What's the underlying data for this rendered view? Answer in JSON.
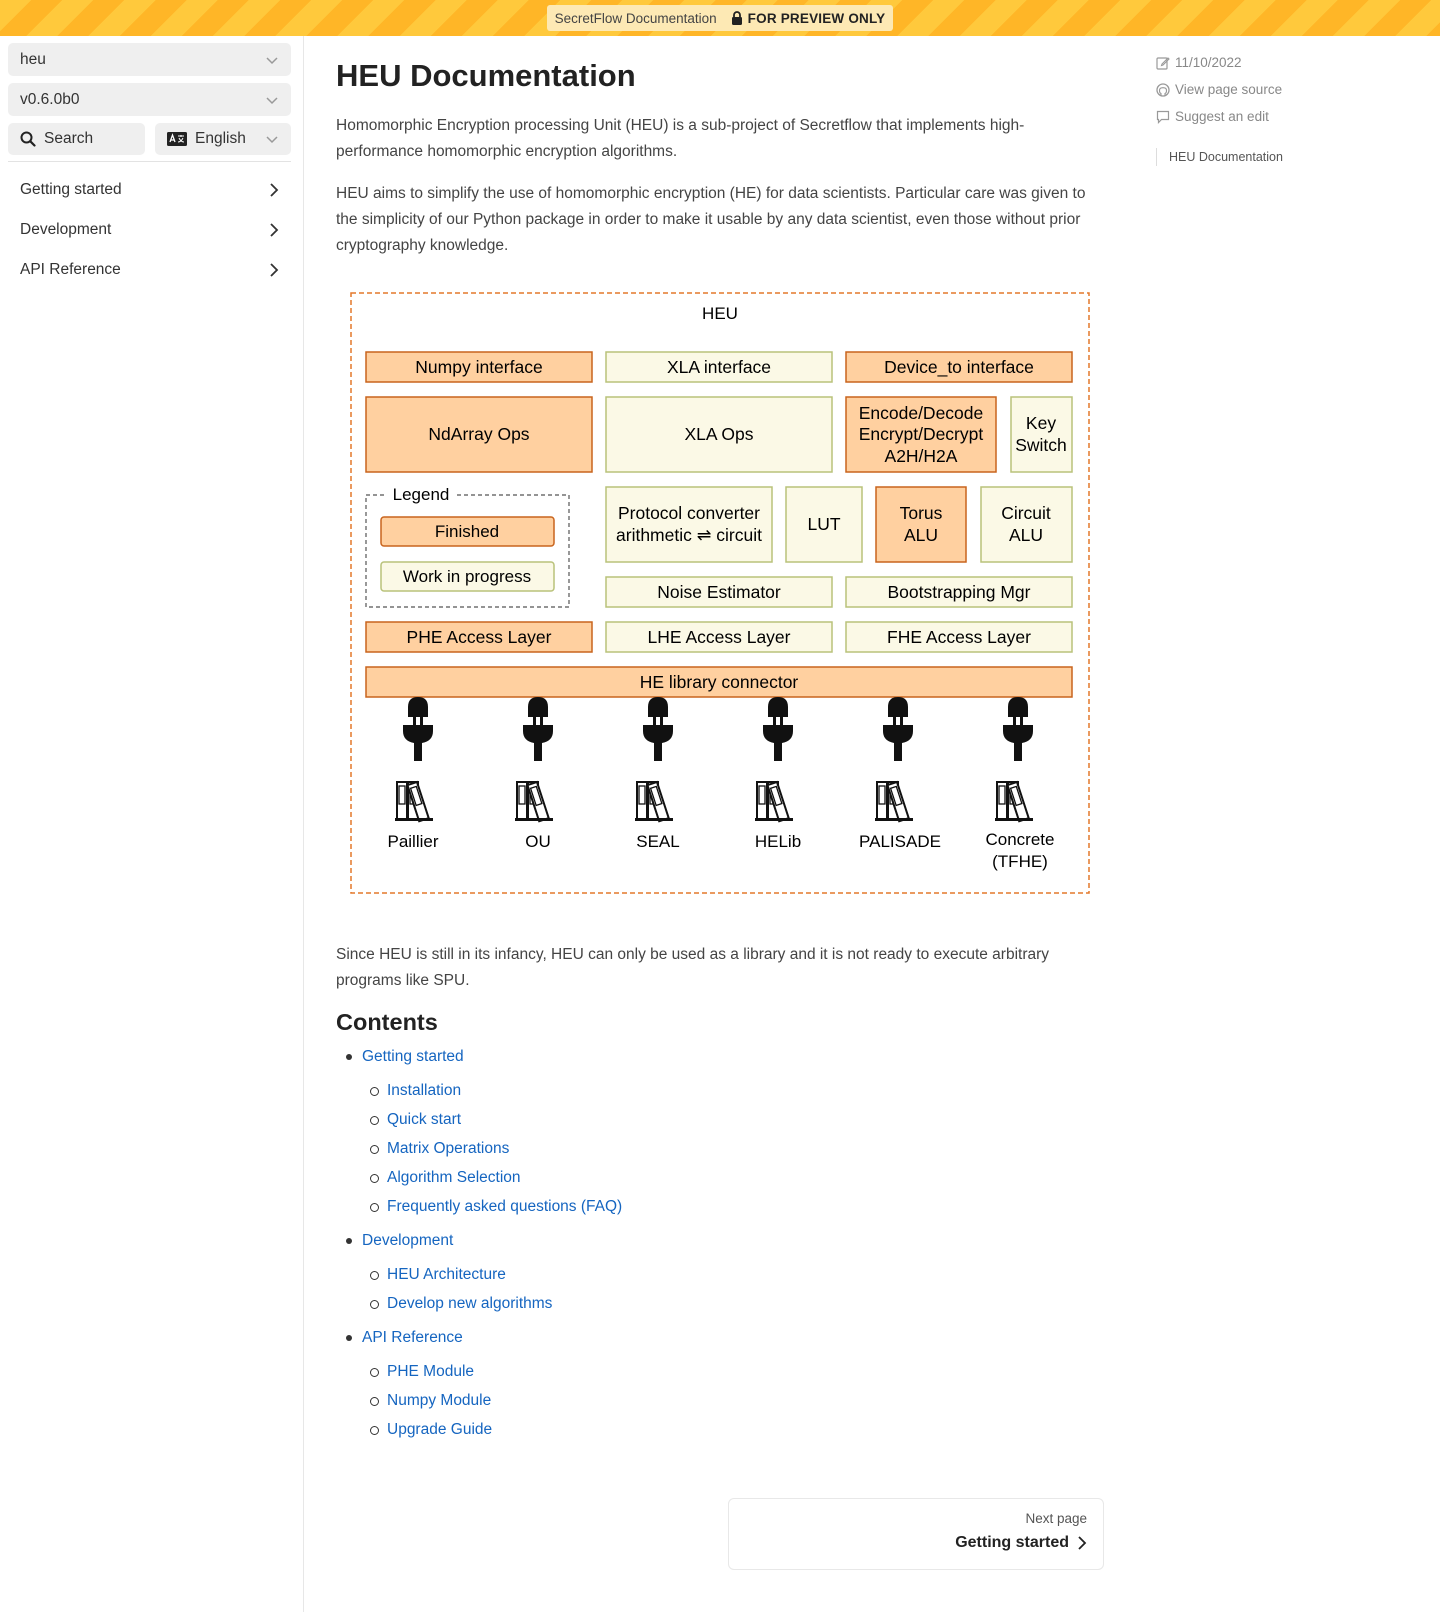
{
  "banner": {
    "site_title": "SecretFlow Documentation",
    "preview_label": "FOR PREVIEW ONLY"
  },
  "sidebar": {
    "project_select": "heu",
    "version_select": "v0.6.0b0",
    "search_label": "Search",
    "language_select": "English",
    "nav": [
      {
        "label": "Getting started"
      },
      {
        "label": "Development"
      },
      {
        "label": "API Reference"
      }
    ]
  },
  "main": {
    "title": "HEU Documentation",
    "para1": "Homomorphic Encryption processing Unit (HEU) is a sub-project of Secretflow that implements high-performance homomorphic encryption algorithms.",
    "para2": "HEU aims to simplify the use of homomorphic encryption (HE) for data scientists. Particular care was given to the simplicity of our Python package in order to make it usable by any data scientist, even those without prior cryptography knowledge.",
    "para3": "Since HEU is still in its infancy, HEU can only be used as a library and it is not ready to execute arbitrary programs like SPU.",
    "contents_heading": "Contents",
    "toc": [
      {
        "label": "Getting started",
        "children": [
          "Installation",
          "Quick start",
          "Matrix Operations",
          "Algorithm Selection",
          "Frequently asked questions (FAQ)"
        ]
      },
      {
        "label": "Development",
        "children": [
          "HEU Architecture",
          "Develop new algorithms"
        ]
      },
      {
        "label": "API Reference",
        "children": [
          "PHE Module",
          "Numpy Module",
          "Upgrade Guide"
        ]
      }
    ],
    "next": {
      "small": "Next page",
      "title": "Getting started"
    }
  },
  "diagram": {
    "title": "HEU",
    "numpy_interface": "Numpy interface",
    "xla_interface": "XLA interface",
    "device_interface": "Device_to interface",
    "ndarray_ops": "NdArray Ops",
    "xla_ops": "XLA Ops",
    "encode_lines": [
      "Encode/Decode",
      "Encrypt/Decrypt",
      "A2H/H2A"
    ],
    "key_switch": [
      "Key",
      "Switch"
    ],
    "legend_title": "Legend",
    "legend_finished": "Finished",
    "legend_wip": "Work in progress",
    "protocol_converter": [
      "Protocol converter",
      "arithmetic ⇌ circuit"
    ],
    "lut": "LUT",
    "torus_alu": [
      "Torus",
      "ALU"
    ],
    "circuit_alu": [
      "Circuit",
      "ALU"
    ],
    "noise_estimator": "Noise Estimator",
    "bootstrapping": "Bootstrapping Mgr",
    "phe_layer": "PHE Access Layer",
    "lhe_layer": "LHE Access Layer",
    "fhe_layer": "FHE Access Layer",
    "connector": "HE library connector",
    "libraries": [
      [
        "Paillier"
      ],
      [
        "OU"
      ],
      [
        "SEAL"
      ],
      [
        "HELib"
      ],
      [
        "PALISADE"
      ],
      [
        "Concrete",
        "(TFHE)"
      ]
    ],
    "colors": {
      "finished_fill": "#ffd0a0",
      "finished_stroke": "#c9641d",
      "wip_fill": "#fbf9e6",
      "wip_stroke": "#b9c27a",
      "border": "#e4782b"
    }
  },
  "right": {
    "date": "11/10/2022",
    "view_source": "View page source",
    "suggest_edit": "Suggest an edit",
    "on_page": "HEU Documentation"
  }
}
